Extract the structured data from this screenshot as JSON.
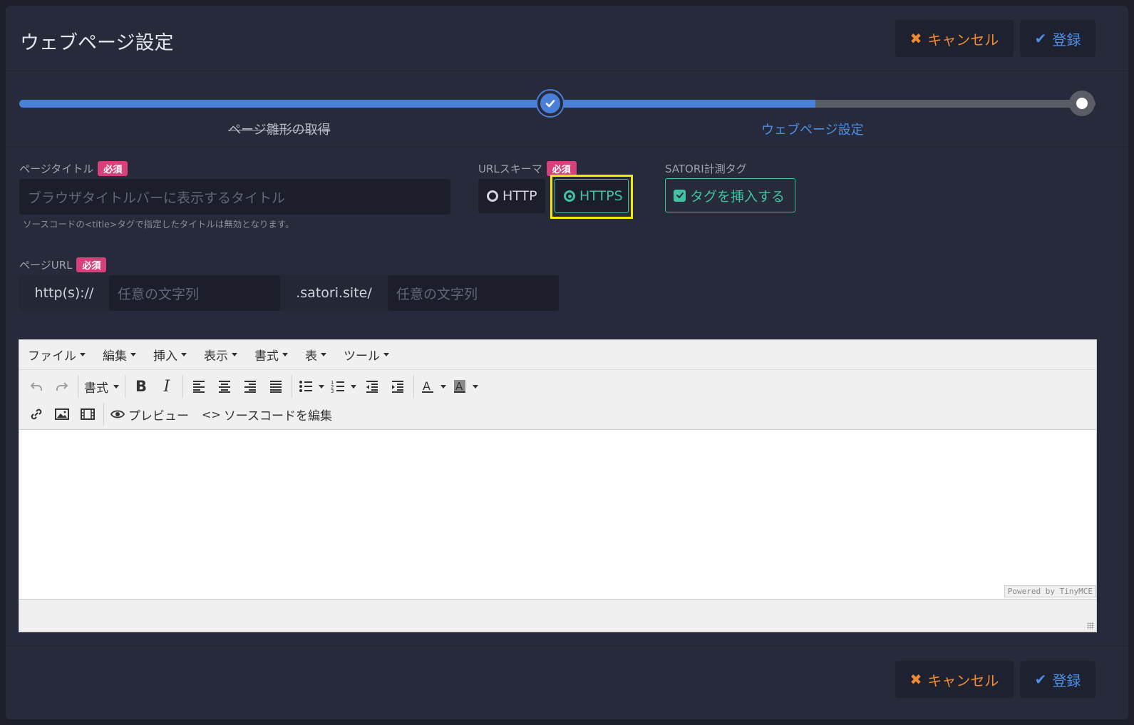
{
  "header": {
    "title": "ウェブページ設定",
    "cancel_label": "キャンセル",
    "register_label": "登録"
  },
  "steps": [
    {
      "label": "ページ雛形の取得",
      "status": "completed"
    },
    {
      "label": "ウェブページ設定",
      "status": "current"
    }
  ],
  "progress_percent": 74,
  "form": {
    "required_badge": "必須",
    "page_title": {
      "label": "ページタイトル",
      "placeholder": "ブラウザタイトルバーに表示するタイトル",
      "help": "ソースコードの<title>タグで指定したタイトルは無効となります。"
    },
    "url_scheme": {
      "label": "URLスキーマ",
      "options": [
        {
          "label": "HTTP",
          "selected": false
        },
        {
          "label": "HTTPS",
          "selected": true
        }
      ]
    },
    "satori_tag": {
      "label": "SATORI計測タグ",
      "checkbox_label": "タグを挿入する",
      "checked": true
    },
    "page_url": {
      "label": "ページURL",
      "prefix": "http(s)://",
      "subdomain_placeholder": "任意の文字列",
      "domain": ".satori.site/",
      "path_placeholder": "任意の文字列"
    }
  },
  "editor": {
    "menu": [
      "ファイル",
      "編集",
      "挿入",
      "表示",
      "書式",
      "表",
      "ツール"
    ],
    "format_label": "書式",
    "preview_label": "プレビュー",
    "source_label": "ソースコードを編集",
    "powered_by": "Powered by TinyMCE"
  },
  "footer": {
    "cancel_label": "キャンセル",
    "register_label": "登録"
  },
  "colors": {
    "accent_blue": "#4a7fd8",
    "cancel_orange": "#f08a32",
    "success_teal": "#3fc3a4",
    "required_pink": "#d8407a",
    "highlight_yellow": "#f2ea06"
  }
}
